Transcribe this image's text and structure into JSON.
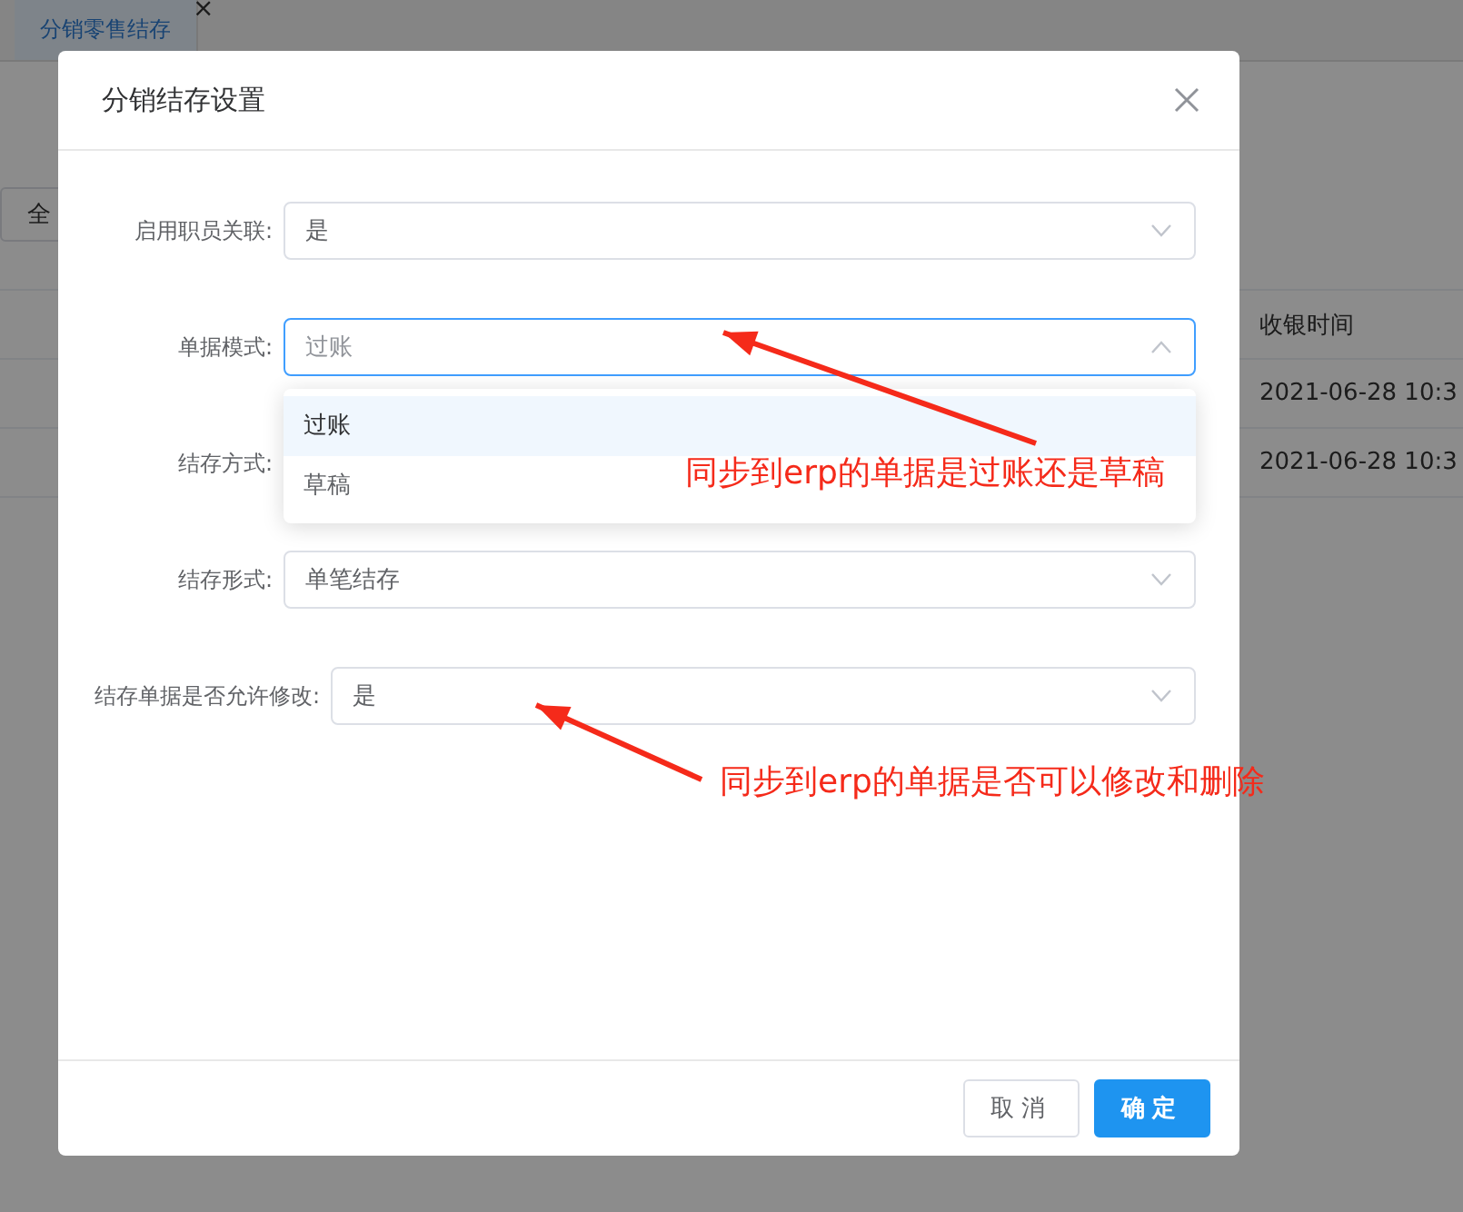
{
  "background": {
    "tab": {
      "label": "分销零售结存",
      "close": "×"
    },
    "button": "全",
    "table": {
      "column": "收银时间",
      "rows": [
        "2021-06-28 10:3",
        "2021-06-28 10:3"
      ]
    }
  },
  "dialog": {
    "title": "分销结存设置",
    "fields": [
      {
        "label": "启用职员关联:",
        "value": "是",
        "open": false
      },
      {
        "label": "单据模式:",
        "value": "过账",
        "open": true,
        "options": [
          {
            "label": "过账",
            "selected": true
          },
          {
            "label": "草稿",
            "selected": false
          }
        ]
      },
      {
        "label": "结存方式:"
      },
      {
        "label": "结存形式:",
        "value": "单笔结存",
        "open": false
      },
      {
        "label": "结存单据是否允许修改:",
        "value": "是",
        "open": false
      }
    ],
    "buttons": [
      {
        "label": "取消",
        "kind": "cancel"
      },
      {
        "label": "确定",
        "kind": "primary"
      }
    ]
  },
  "annotations": [
    "同步到erp的单据是过账还是草稿",
    "同步到erp的单据是否可以修改和删除"
  ]
}
